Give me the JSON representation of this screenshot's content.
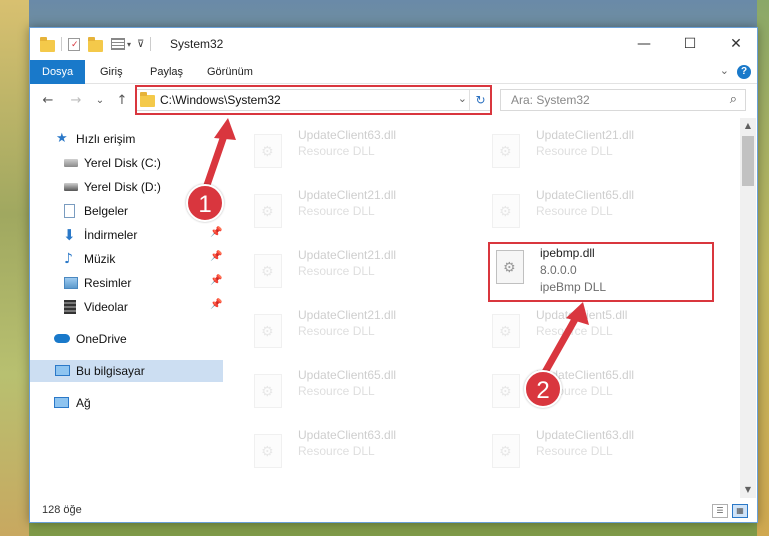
{
  "window": {
    "title": "System32",
    "minimize": "—",
    "maximize": "☐",
    "close": "✕"
  },
  "ribbon": {
    "tabs": [
      "Dosya",
      "Giriş",
      "Paylaş",
      "Görünüm"
    ],
    "active_tab": "Dosya",
    "collapse": "⌄",
    "help": "?"
  },
  "nav": {
    "back": "←",
    "forward": "→",
    "recent": "⌄",
    "up": "↑",
    "path": "C:\\Windows\\System32",
    "dropdown": "⌄",
    "refresh": "↻"
  },
  "search": {
    "placeholder": "Ara: System32",
    "icon": "⌕"
  },
  "sidebar": {
    "items": [
      {
        "label": "Hızlı erişim",
        "icon": "star-icon",
        "pinned": false
      },
      {
        "label": "Yerel Disk (C:)",
        "icon": "drive-icon",
        "pinned": false
      },
      {
        "label": "Yerel Disk (D:)",
        "icon": "drive-icon",
        "pinned": false
      },
      {
        "label": "Belgeler",
        "icon": "document-icon",
        "pinned": true
      },
      {
        "label": "İndirmeler",
        "icon": "download-icon",
        "pinned": true
      },
      {
        "label": "Müzik",
        "icon": "music-icon",
        "pinned": true
      },
      {
        "label": "Resimler",
        "icon": "pictures-icon",
        "pinned": true
      },
      {
        "label": "Videolar",
        "icon": "video-icon",
        "pinned": true
      },
      {
        "label": "OneDrive",
        "icon": "cloud-icon",
        "pinned": false
      },
      {
        "label": "Bu bilgisayar",
        "icon": "computer-icon",
        "pinned": false,
        "selected": true
      },
      {
        "label": "Ağ",
        "icon": "network-icon",
        "pinned": false
      }
    ],
    "pin_glyph": "📌"
  },
  "files": [
    {
      "name": "UpdateClient63.dll",
      "type": "Resource DLL",
      "faded": true
    },
    {
      "name": "UpdateClient21.dll",
      "type": "Resource DLL",
      "faded": true
    },
    {
      "name": "UpdateClient21.dll",
      "type": "Resource DLL",
      "faded": true
    },
    {
      "name": "UpdateClient65.dll",
      "type": "Resource DLL",
      "faded": true
    },
    {
      "name": "UpdateClient21.dll",
      "type": "Resource DLL",
      "faded": true
    },
    {
      "name": "ipebmp.dll",
      "version": "8.0.0.0",
      "type": "ipeBmp DLL",
      "faded": false
    },
    {
      "name": "UpdateClient21.dll",
      "type": "Resource DLL",
      "faded": true
    },
    {
      "name": "UpdateClient5.dll",
      "type": "Resource DLL",
      "faded": true
    },
    {
      "name": "UpdateClient65.dll",
      "type": "Resource DLL",
      "faded": true
    },
    {
      "name": "UpdateClient65.dll",
      "type": "Resource DLL",
      "faded": true
    },
    {
      "name": "UpdateClient63.dll",
      "type": "Resource DLL",
      "faded": true
    },
    {
      "name": "UpdateClient63.dll",
      "type": "Resource DLL",
      "faded": true
    }
  ],
  "status": {
    "count": "128 öğe"
  },
  "annotations": [
    {
      "number": "1",
      "color": "#d9363e"
    },
    {
      "number": "2",
      "color": "#d9363e"
    }
  ]
}
